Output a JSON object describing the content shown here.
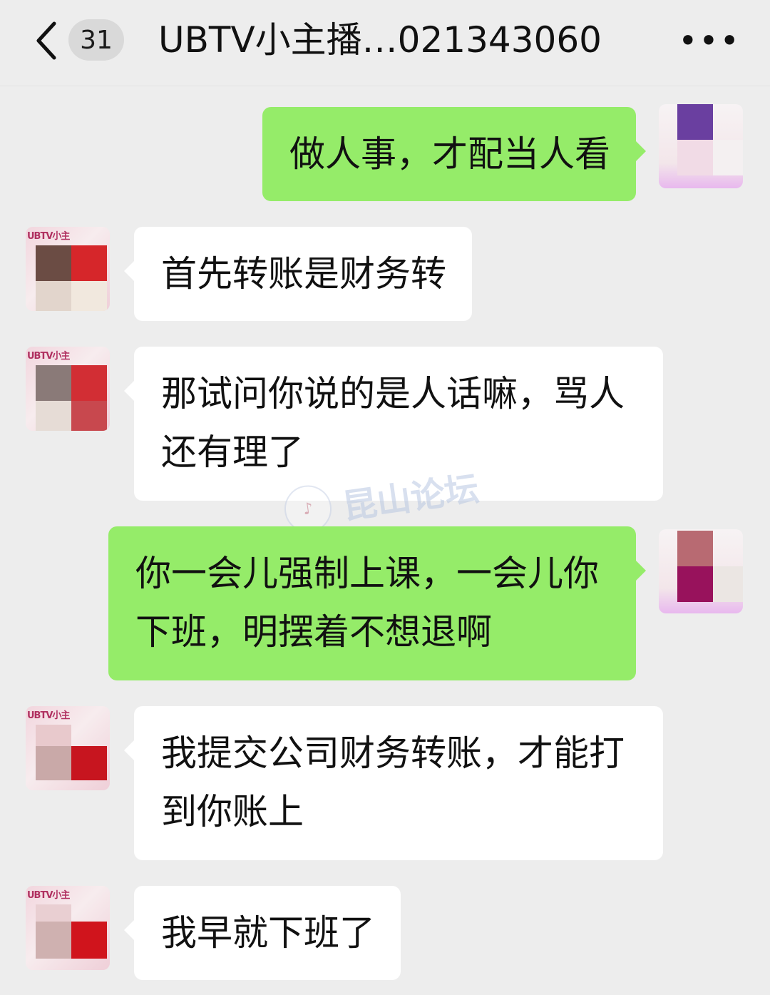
{
  "header": {
    "back_icon": "chevron-left-icon",
    "unread_count": "31",
    "title": "UBTV小主播…021343060",
    "more_icon": "ellipsis-icon",
    "more_label": "•••"
  },
  "messages": [
    {
      "direction": "sent",
      "text": "做人事，才配当人看"
    },
    {
      "direction": "received",
      "text": "首先转账是财务转"
    },
    {
      "direction": "received",
      "text": "那试问你说的是人话嘛，骂人还有理了"
    },
    {
      "direction": "sent",
      "text": "你一会儿强制上课，一会儿你下班，明摆着不想退啊"
    },
    {
      "direction": "received",
      "text": "我提交公司财务转账，才能打到你账上"
    },
    {
      "direction": "received",
      "text": "我早就下班了"
    }
  ],
  "avatar_banner_text": "UBTV小主",
  "watermark": {
    "text": "昆山论坛",
    "logo_glyph": "♪"
  },
  "colors": {
    "background": "#ededed",
    "sent_bubble": "#95ec69",
    "received_bubble": "#ffffff"
  }
}
